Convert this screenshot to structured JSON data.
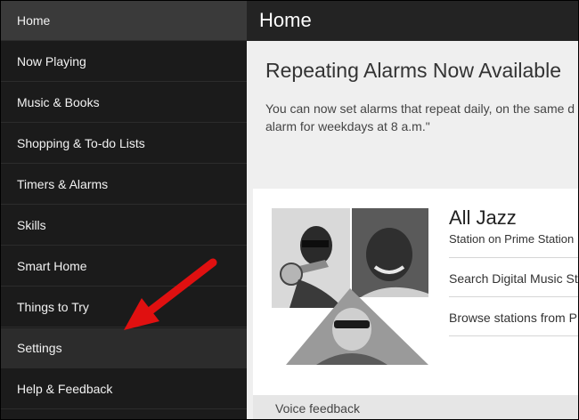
{
  "sidebar": {
    "items": [
      {
        "label": "Home"
      },
      {
        "label": "Now Playing"
      },
      {
        "label": "Music & Books"
      },
      {
        "label": "Shopping & To-do Lists"
      },
      {
        "label": "Timers & Alarms"
      },
      {
        "label": "Skills"
      },
      {
        "label": "Smart Home"
      },
      {
        "label": "Things to Try"
      },
      {
        "label": "Settings"
      },
      {
        "label": "Help & Feedback"
      }
    ]
  },
  "header": {
    "title": "Home"
  },
  "announcement": {
    "title": "Repeating Alarms Now Available",
    "line1": "You can now set alarms that repeat daily, on the same d",
    "line2": "alarm for weekdays at 8 a.m.\""
  },
  "station": {
    "name": "All Jazz",
    "subtitle": "Station on Prime Station",
    "link1": "Search Digital Music St",
    "link2": "Browse stations from P"
  },
  "voice_feedback": {
    "label": "Voice feedback"
  },
  "colors": {
    "sidebar_bg": "#1b1b1b",
    "header_bg": "#232323",
    "arrow": "#e01010"
  }
}
